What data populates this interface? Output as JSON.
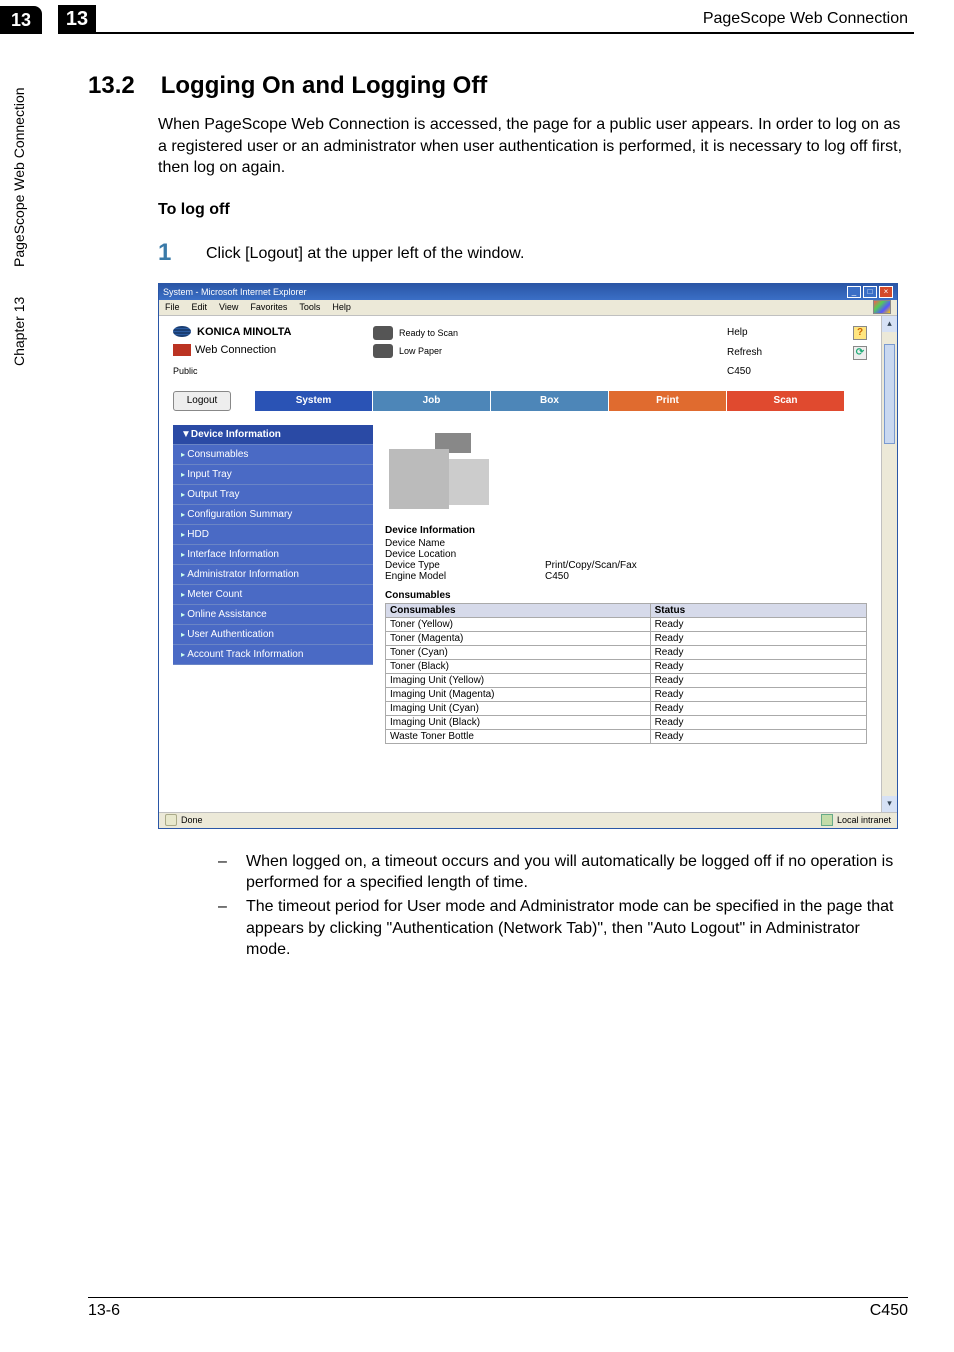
{
  "side": {
    "num": "13",
    "vert1": "PageScope Web Connection",
    "vert2": "Chapter 13"
  },
  "top": {
    "num": "13",
    "title": "PageScope Web Connection"
  },
  "section": {
    "num": "13.2",
    "title": "Logging On and Logging Off"
  },
  "para": "When PageScope Web Connection is accessed, the page for a public user appears. In order to log on as a registered user or an administrator when user authentication is performed, it is necessary to log off first, then log on again.",
  "subhead": "To log off",
  "step": {
    "num": "1",
    "text": "Click [Logout] at the upper left of the window."
  },
  "shot": {
    "win_title": "System - Microsoft Internet Explorer",
    "menus": [
      "File",
      "Edit",
      "View",
      "Favorites",
      "Tools",
      "Help"
    ],
    "brand": "KONICA MINOLTA",
    "pagescope_label": "Web Connection",
    "pagescope_icon_label": "PAGE SCOPE",
    "public": "Public",
    "status1": "Ready to Scan",
    "status2": "Low Paper",
    "links": {
      "help": "Help",
      "refresh": "Refresh",
      "model": "C450"
    },
    "help_icon": "?",
    "refresh_icon": "⟳",
    "logout": "Logout",
    "tabs": [
      "System",
      "Job",
      "Box",
      "Print",
      "Scan"
    ],
    "nav": [
      {
        "label": "▼Device Information",
        "cls": "hdr"
      },
      {
        "label": "Consumables",
        "cls": "sub"
      },
      {
        "label": "Input Tray",
        "cls": "sub"
      },
      {
        "label": "Output Tray",
        "cls": "sub"
      },
      {
        "label": "Configuration Summary",
        "cls": "sub"
      },
      {
        "label": "HDD",
        "cls": "sub"
      },
      {
        "label": "Interface Information",
        "cls": "sub"
      },
      {
        "label": "Administrator Information",
        "cls": "sub"
      },
      {
        "label": "Meter Count",
        "cls": "sub"
      },
      {
        "label": "Online Assistance",
        "cls": "sub"
      },
      {
        "label": "User Authentication",
        "cls": "sub"
      },
      {
        "label": "Account Track Information",
        "cls": "sub"
      }
    ],
    "dev_info_h": "Device Information",
    "dev_rows": [
      {
        "k": "Device Name",
        "v": ""
      },
      {
        "k": "Device Location",
        "v": ""
      },
      {
        "k": "Device Type",
        "v": "Print/Copy/Scan/Fax"
      },
      {
        "k": "Engine Model",
        "v": "C450"
      }
    ],
    "cons_h": "Consumables",
    "cons_th1": "Consumables",
    "cons_th2": "Status",
    "cons_rows": [
      {
        "k": "Toner (Yellow)",
        "v": "Ready"
      },
      {
        "k": "Toner (Magenta)",
        "v": "Ready"
      },
      {
        "k": "Toner (Cyan)",
        "v": "Ready"
      },
      {
        "k": "Toner (Black)",
        "v": "Ready"
      },
      {
        "k": "Imaging Unit (Yellow)",
        "v": "Ready"
      },
      {
        "k": "Imaging Unit (Magenta)",
        "v": "Ready"
      },
      {
        "k": "Imaging Unit (Cyan)",
        "v": "Ready"
      },
      {
        "k": "Imaging Unit (Black)",
        "v": "Ready"
      },
      {
        "k": "Waste Toner Bottle",
        "v": "Ready"
      }
    ],
    "status_done": "Done",
    "status_zone": "Local intranet"
  },
  "bullets": [
    "When logged on, a timeout occurs and you will automatically be logged off if no operation is performed for a specified length of time.",
    "The timeout period for User mode and Administrator mode can be specified in the page that appears by clicking \"Authentication (Network Tab)\", then \"Auto Logout\" in Administrator mode."
  ],
  "footer": {
    "left": "13-6",
    "right": "C450"
  }
}
